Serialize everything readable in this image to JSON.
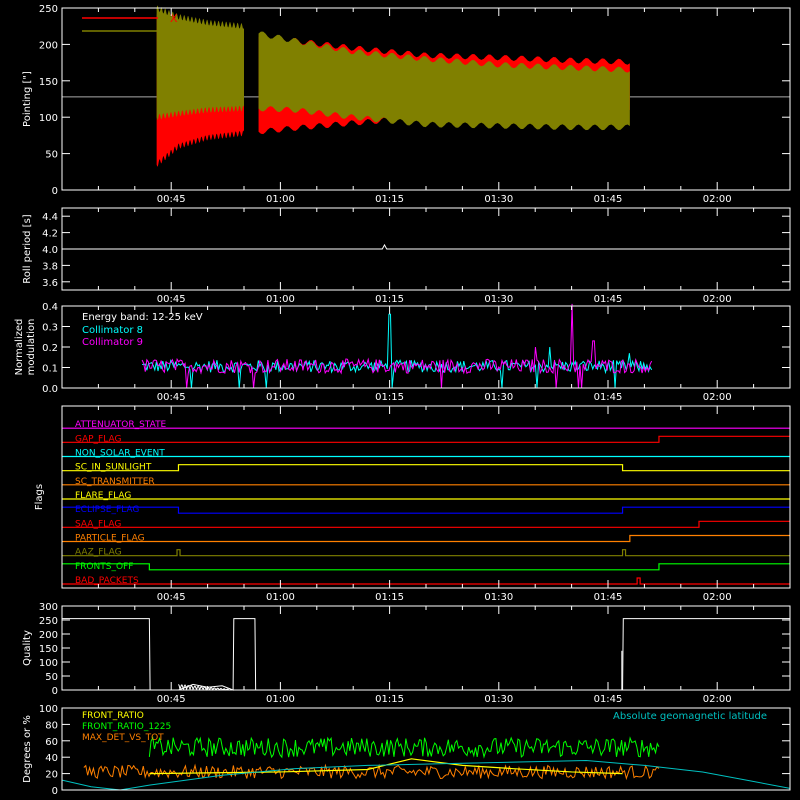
{
  "time_axis": {
    "unit": "minutes after 00:00 UT",
    "range": [
      0.0,
      0.0
    ],
    "start": "00:30",
    "end": "02:10",
    "ticks": [
      "00:45",
      "01:00",
      "01:15",
      "01:30",
      "01:45",
      "02:00"
    ]
  },
  "colors": {
    "background": "#000000",
    "frame": "#ffffff",
    "pointing_x": "#ff0000",
    "pointing_y": "#808000",
    "collimator_8": "#00ffff",
    "collimator_9": "#ff00ff",
    "front_ratio": "#ffff00",
    "front_ratio_1225": "#00ff00",
    "max_det": "#ff8000",
    "geomag": "#00c0c0"
  },
  "chart_data": [
    {
      "id": "pointing",
      "type": "area",
      "ylabel": "Pointing [\"]",
      "ylim": [
        0,
        250
      ],
      "yticks": [
        0,
        50,
        100,
        150,
        200,
        250
      ],
      "reference_line": 128,
      "series": [
        {
          "name": "X",
          "color": "#ff0000",
          "segments": [
            {
              "x": [
                43.0,
                46.0,
                50.0,
                55.0
              ],
              "low": [
                35,
                60,
                72,
                78
              ],
              "high": [
                240,
                218,
                210,
                205
              ]
            },
            {
              "x": [
                57.0,
                62.0,
                70.0,
                80.0,
                90.0,
                100.0,
                108.0
              ],
              "low": [
                80,
                85,
                92,
                100,
                103,
                106,
                108
              ],
              "high": [
                210,
                205,
                195,
                185,
                182,
                178,
                176
              ]
            }
          ]
        },
        {
          "name": "Y",
          "color": "#808000",
          "segments": [
            {
              "x": [
                43.0,
                46.0,
                50.0,
                55.0
              ],
              "low": [
                100,
                105,
                110,
                112
              ],
              "high": [
                250,
                238,
                230,
                225
              ]
            },
            {
              "x": [
                57.0,
                62.0,
                70.0,
                80.0,
                90.0,
                100.0,
                108.0
              ],
              "low": [
                112,
                110,
                100,
                90,
                88,
                86,
                86
              ],
              "high": [
                215,
                205,
                190,
                180,
                172,
                168,
                165
              ]
            }
          ]
        }
      ]
    },
    {
      "id": "roll",
      "type": "line",
      "ylabel": "Roll period [s]",
      "ylim": [
        3.5,
        4.5
      ],
      "yticks": [
        3.6,
        3.8,
        4.0,
        4.2,
        4.4
      ],
      "series": [
        {
          "name": "",
          "color": "#ffffff",
          "x": [
            30.0,
            40.0,
            50.0,
            60.0,
            70.0,
            74.0,
            74.3,
            74.6,
            80.0,
            90.0,
            100.0,
            110.0,
            120.0,
            130.0
          ],
          "y": [
            4.0,
            4.0,
            4.0,
            4.0,
            4.0,
            4.0,
            4.05,
            4.0,
            4.0,
            4.0,
            4.0,
            4.0,
            4.0,
            4.0
          ]
        }
      ]
    },
    {
      "id": "modulation",
      "type": "line",
      "ylabel": "Normalized modulation",
      "ylim": [
        0.0,
        0.4
      ],
      "yticks": [
        0.0,
        0.1,
        0.2,
        0.3,
        0.4
      ],
      "legend_title": "Energy band: 12-25 keV",
      "active_range": [
        41.0,
        111.0
      ],
      "series": [
        {
          "name": "Collimator 8",
          "color": "#00ffff",
          "base": 0.1,
          "spread": 0.06,
          "spikes": [
            [
              75.0,
              0.36
            ],
            [
              97.0,
              0.2
            ],
            [
              108.0,
              0.17
            ]
          ]
        },
        {
          "name": "Collimator 9",
          "color": "#ff00ff",
          "base": 0.1,
          "spread": 0.07,
          "spikes": [
            [
              100.0,
              0.41
            ],
            [
              95.0,
              0.2
            ],
            [
              103.0,
              0.23
            ]
          ]
        }
      ]
    },
    {
      "id": "flags",
      "type": "line",
      "ylabel": "Flags",
      "series": [
        {
          "name": "ATTENUATOR_STATE",
          "color": "#ff00ff",
          "steps": []
        },
        {
          "name": "GAP_FLAG",
          "color": "#ff0000",
          "steps": [
            [
              112.0,
              1
            ]
          ]
        },
        {
          "name": "NON_SOLAR_EVENT",
          "color": "#00ffff",
          "steps": []
        },
        {
          "name": "SC_IN_SUNLIGHT",
          "color": "#ffff00",
          "steps": [
            [
              46.0,
              1
            ],
            [
              107.0,
              0
            ]
          ]
        },
        {
          "name": "SC_TRANSMITTER",
          "color": "#ff8000",
          "steps": []
        },
        {
          "name": "FLARE_FLAG",
          "color": "#ffff00",
          "steps": []
        },
        {
          "name": "ECLIPSE_FLAG",
          "color": "#0000ff",
          "steps": [
            [
              0,
              1
            ],
            [
              46.0,
              0
            ],
            [
              107.0,
              1
            ]
          ]
        },
        {
          "name": "SAA_FLAG",
          "color": "#ff0000",
          "steps": [
            [
              117.5,
              1
            ]
          ]
        },
        {
          "name": "PARTICLE_FLAG",
          "color": "#ff8000",
          "steps": [
            [
              108.0,
              1
            ]
          ]
        },
        {
          "name": "AAZ_FLAG",
          "color": "#808000",
          "pulses": [
            45.8,
            107.0
          ]
        },
        {
          "name": "FRONTS_OFF",
          "color": "#00ff00",
          "steps": [
            [
              0,
              1
            ],
            [
              42.0,
              0
            ],
            [
              112.0,
              1
            ]
          ]
        },
        {
          "name": "BAD_PACKETS",
          "color": "#ff0000",
          "pulses": [
            109.0
          ]
        }
      ]
    },
    {
      "id": "quality",
      "type": "line",
      "ylabel": "Quality",
      "ylim": [
        0,
        300
      ],
      "yticks": [
        0,
        50,
        100,
        150,
        200,
        250,
        300
      ],
      "series": [
        {
          "name": "",
          "color": "#ffffff",
          "x": [
            30.0,
            42.0,
            42.1,
            46.0,
            48.0,
            50.0,
            52.0,
            53.5,
            53.6,
            56.5,
            56.6,
            107.0,
            107.1,
            130.0
          ],
          "y": [
            255,
            255,
            0,
            0,
            20,
            10,
            15,
            0,
            255,
            255,
            0,
            0,
            255,
            255
          ]
        }
      ]
    },
    {
      "id": "ratios",
      "type": "line",
      "ylabel": "Degrees or %",
      "ylim": [
        0,
        100
      ],
      "yticks": [
        0,
        20,
        40,
        60,
        80,
        100
      ],
      "annotation": "Absolute geomagnetic latitude",
      "series": [
        {
          "name": "FRONT_RATIO",
          "color": "#ffff00",
          "x": [
            42.0,
            60.0,
            72.0,
            78.0,
            85.0,
            92.0,
            100.0,
            107.0
          ],
          "y": [
            20,
            22,
            25,
            38,
            30,
            26,
            22,
            20
          ]
        },
        {
          "name": "FRONT_RATIO_1225",
          "color": "#00ff00",
          "active_range": [
            42.0,
            112.0
          ],
          "base": 52,
          "spread": 12
        },
        {
          "name": "MAX_DET_VS_TOT",
          "color": "#ff8000",
          "active_range": [
            33.0,
            112.0
          ],
          "base": 22,
          "spread": 8
        },
        {
          "name": "",
          "color": "#00c0c0",
          "x": [
            30.0,
            34.0,
            38.0,
            42.0,
            52.0,
            62.0,
            72.0,
            82.0,
            92.0,
            102.0,
            110.0,
            118.0,
            124.0,
            130.0
          ],
          "y": [
            12,
            4,
            0,
            6,
            18,
            26,
            30,
            32,
            34,
            36,
            30,
            22,
            12,
            2
          ]
        }
      ]
    }
  ]
}
